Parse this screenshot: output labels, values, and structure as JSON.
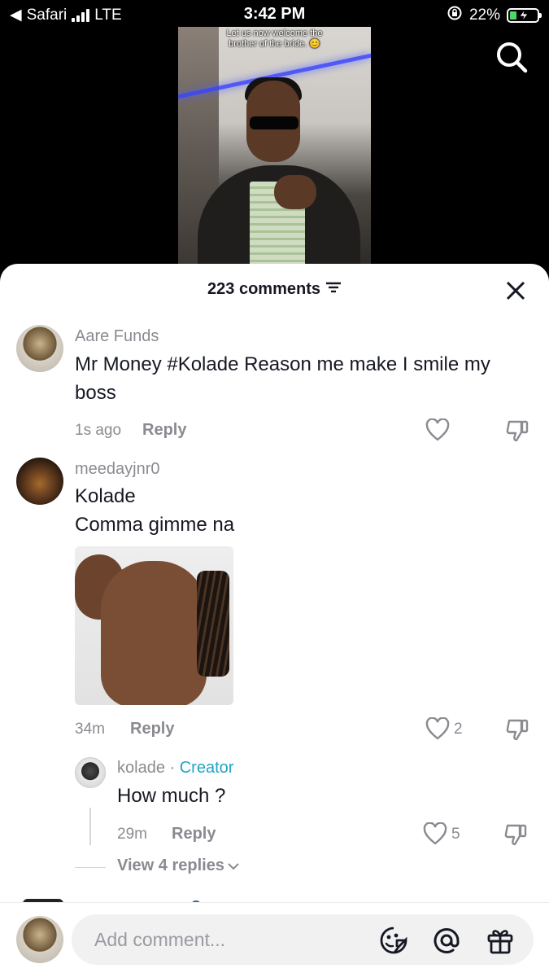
{
  "status_bar": {
    "back_app": "Safari",
    "network": "LTE",
    "time": "3:42 PM",
    "battery": "22%"
  },
  "video": {
    "caption_line1": "Let us now welcome the",
    "caption_line2": "brother of the bride. 😊"
  },
  "sheet": {
    "comment_count": "223 comments"
  },
  "comments": [
    {
      "username": "Aare Funds",
      "text_line1": "Mr Money #Kolade Reason me make I smile my",
      "text_line2": "boss",
      "time": "1s ago",
      "reply_label": "Reply"
    },
    {
      "username": "meedayjnr0",
      "text_line1": "Kolade",
      "text_line2": "Comma gimme na",
      "time": "34m",
      "reply_label": "Reply",
      "likes": "2"
    }
  ],
  "reply": {
    "username": "kolade",
    "separator": " · ",
    "badge": "Creator",
    "text": "How much ?",
    "time": "29m",
    "reply_label": "Reply",
    "likes": "5"
  },
  "view_replies": "View 4 replies",
  "footer": {
    "placeholder": "Add comment..."
  },
  "icons": {
    "search": "search-icon",
    "close": "close-icon",
    "filter": "filter-icon",
    "like": "heart-icon",
    "dislike": "thumbs-down-icon",
    "emoji": "emoji-icon",
    "mention": "at-icon",
    "gift": "gift-icon"
  }
}
